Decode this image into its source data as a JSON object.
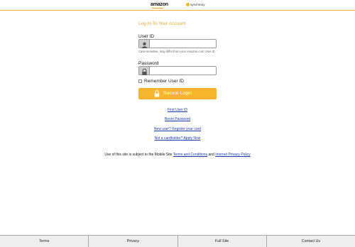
{
  "header": {
    "amazon_logo": "amazon",
    "synchrony_logo": "synchrony"
  },
  "login": {
    "title": "Log In To Your Account",
    "user_id_label": "User ID",
    "user_id_value": "",
    "user_id_hint": "Case-sensitive, may differ from your Amazon.com User ID",
    "password_label": "Password",
    "password_value": "",
    "remember_label": "Remember User ID",
    "button_label": "Secure Login"
  },
  "links": {
    "find_user_id": "Find User ID",
    "reset_password": "Reset Password",
    "register": "New user? Register your card",
    "apply": "Not a cardholder? Apply Now"
  },
  "terms": {
    "prefix": "Use of this site is subject to the Mobile Site",
    "terms_link": "Terms and Conditions",
    "and": "and",
    "privacy_link": "Internet Privacy Policy"
  },
  "footer": {
    "items": [
      "Terms",
      "Privacy",
      "Full Site",
      "Contact Us"
    ]
  },
  "colors": {
    "accent": "#f7b52f",
    "link": "#1a3cab"
  }
}
